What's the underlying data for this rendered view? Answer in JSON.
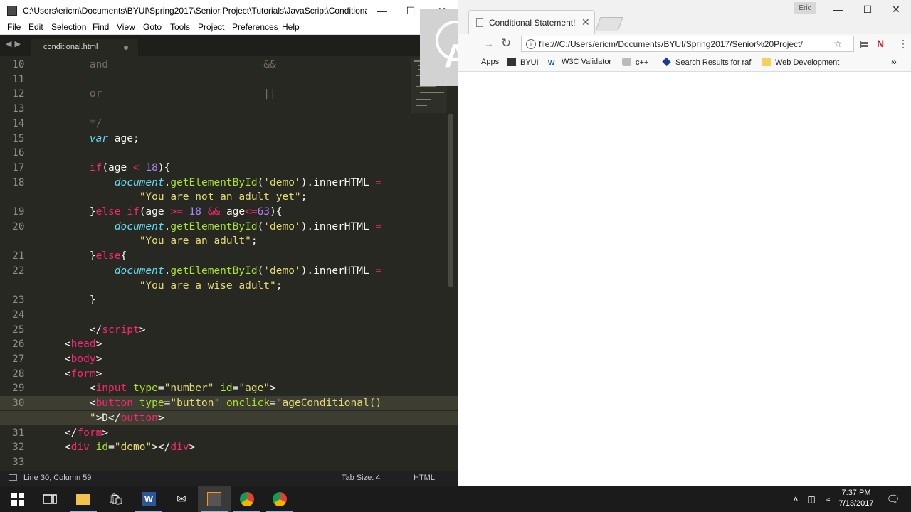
{
  "sublime": {
    "title": "C:\\Users\\ericm\\Documents\\BYUI\\Spring2017\\Senior Project\\Tutorials\\JavaScript\\Conditional St...",
    "menu": [
      "File",
      "Edit",
      "Selection",
      "Find",
      "View",
      "Goto",
      "Tools",
      "Project",
      "Preferences",
      "Help"
    ],
    "tab_label": "conditional.html",
    "status": {
      "position": "Line 30, Column 59",
      "tab_size": "Tab Size: 4",
      "syntax": "HTML"
    },
    "lines": [
      {
        "num": "10",
        "tokens": [
          [
            "c",
            "        and                         &&"
          ]
        ]
      },
      {
        "num": "11",
        "tokens": []
      },
      {
        "num": "12",
        "tokens": [
          [
            "c",
            "        or                          ||"
          ]
        ]
      },
      {
        "num": "13",
        "tokens": []
      },
      {
        "num": "14",
        "tokens": [
          [
            "c",
            "        */"
          ]
        ]
      },
      {
        "num": "15",
        "tokens": [
          [
            "w",
            "        "
          ],
          [
            "i",
            "var"
          ],
          [
            "w",
            " age;"
          ]
        ]
      },
      {
        "num": "16",
        "tokens": []
      },
      {
        "num": "17",
        "tokens": [
          [
            "w",
            "        "
          ],
          [
            "k",
            "if"
          ],
          [
            "w",
            "(age "
          ],
          [
            "k",
            "<"
          ],
          [
            "w",
            " "
          ],
          [
            "n",
            "18"
          ],
          [
            "w",
            "){"
          ]
        ]
      },
      {
        "num": "18",
        "tokens": [
          [
            "w",
            "            "
          ],
          [
            "i",
            "document"
          ],
          [
            "w",
            "."
          ],
          [
            "f",
            "getElementById"
          ],
          [
            "w",
            "("
          ],
          [
            "s",
            "'demo'"
          ],
          [
            "w",
            ").innerHTML "
          ],
          [
            "k",
            "="
          ]
        ]
      },
      {
        "num": "",
        "tokens": [
          [
            "w",
            "                "
          ],
          [
            "s",
            "\"You are not an adult yet\""
          ],
          [
            "w",
            ";"
          ]
        ]
      },
      {
        "num": "19",
        "tokens": [
          [
            "w",
            "        }"
          ],
          [
            "k",
            "else if"
          ],
          [
            "w",
            "(age "
          ],
          [
            "k",
            ">="
          ],
          [
            "w",
            " "
          ],
          [
            "n",
            "18"
          ],
          [
            "w",
            " "
          ],
          [
            "k",
            "&&"
          ],
          [
            "w",
            " age"
          ],
          [
            "k",
            "<="
          ],
          [
            "n",
            "63"
          ],
          [
            "w",
            "){"
          ]
        ]
      },
      {
        "num": "20",
        "tokens": [
          [
            "w",
            "            "
          ],
          [
            "i",
            "document"
          ],
          [
            "w",
            "."
          ],
          [
            "f",
            "getElementById"
          ],
          [
            "w",
            "("
          ],
          [
            "s",
            "'demo'"
          ],
          [
            "w",
            ").innerHTML "
          ],
          [
            "k",
            "="
          ]
        ]
      },
      {
        "num": "",
        "tokens": [
          [
            "w",
            "                "
          ],
          [
            "s",
            "\"You are an adult\""
          ],
          [
            "w",
            ";"
          ]
        ]
      },
      {
        "num": "21",
        "tokens": [
          [
            "w",
            "        }"
          ],
          [
            "k",
            "else"
          ],
          [
            "w",
            "{"
          ]
        ]
      },
      {
        "num": "22",
        "tokens": [
          [
            "w",
            "            "
          ],
          [
            "i",
            "document"
          ],
          [
            "w",
            "."
          ],
          [
            "f",
            "getElementById"
          ],
          [
            "w",
            "("
          ],
          [
            "s",
            "'demo'"
          ],
          [
            "w",
            ").innerHTML "
          ],
          [
            "k",
            "="
          ]
        ]
      },
      {
        "num": "",
        "tokens": [
          [
            "w",
            "                "
          ],
          [
            "s",
            "\"You are a wise adult\""
          ],
          [
            "w",
            ";"
          ]
        ]
      },
      {
        "num": "23",
        "tokens": [
          [
            "w",
            "        }"
          ]
        ]
      },
      {
        "num": "24",
        "tokens": []
      },
      {
        "num": "25",
        "tokens": [
          [
            "w",
            "        </"
          ],
          [
            "k",
            "script"
          ],
          [
            "w",
            ">"
          ]
        ]
      },
      {
        "num": "26",
        "tokens": [
          [
            "w",
            "    <"
          ],
          [
            "k",
            "head"
          ],
          [
            "w",
            ">"
          ]
        ]
      },
      {
        "num": "27",
        "tokens": [
          [
            "w",
            "    <"
          ],
          [
            "k",
            "body"
          ],
          [
            "w",
            ">"
          ]
        ]
      },
      {
        "num": "28",
        "tokens": [
          [
            "w",
            "    <"
          ],
          [
            "k",
            "form"
          ],
          [
            "w",
            ">"
          ]
        ]
      },
      {
        "num": "29",
        "tokens": [
          [
            "w",
            "        <"
          ],
          [
            "k",
            "input"
          ],
          [
            "w",
            " "
          ],
          [
            "a",
            "type"
          ],
          [
            "w",
            "="
          ],
          [
            "s",
            "\"number\""
          ],
          [
            "w",
            " "
          ],
          [
            "a",
            "id"
          ],
          [
            "w",
            "="
          ],
          [
            "s",
            "\"age\""
          ],
          [
            "w",
            ">"
          ]
        ]
      },
      {
        "num": "30",
        "current": true,
        "tokens": [
          [
            "w",
            "        <"
          ],
          [
            "k",
            "button"
          ],
          [
            "w",
            " "
          ],
          [
            "a",
            "type"
          ],
          [
            "w",
            "="
          ],
          [
            "s",
            "\"button\""
          ],
          [
            "w",
            " "
          ],
          [
            "a",
            "onclick"
          ],
          [
            "w",
            "="
          ],
          [
            "s",
            "\"ageConditional()"
          ]
        ]
      },
      {
        "num": "",
        "current": true,
        "tokens": [
          [
            "w",
            "        "
          ],
          [
            "s",
            "\""
          ],
          [
            "w",
            ">D</"
          ],
          [
            "k",
            "button"
          ],
          [
            "w",
            ">"
          ]
        ]
      },
      {
        "num": "31",
        "tokens": [
          [
            "w",
            "    </"
          ],
          [
            "k",
            "form"
          ],
          [
            "w",
            ">"
          ]
        ]
      },
      {
        "num": "32",
        "tokens": [
          [
            "w",
            "    <"
          ],
          [
            "k",
            "div"
          ],
          [
            "w",
            " "
          ],
          [
            "a",
            "id"
          ],
          [
            "w",
            "="
          ],
          [
            "s",
            "\"demo\""
          ],
          [
            "w",
            "></"
          ],
          [
            "k",
            "div"
          ],
          [
            "w",
            ">"
          ]
        ]
      },
      {
        "num": "33",
        "tokens": []
      }
    ]
  },
  "chrome": {
    "tab_title": "Conditional Statement!",
    "user_label": "Eric",
    "url": "file:///C:/Users/ericm/Documents/BYUI/Spring2017/Senior%20Project/",
    "bookmarks": [
      {
        "label": "Apps",
        "icon": "apps-icon"
      },
      {
        "label": "BYUI",
        "icon": "byui-icon"
      },
      {
        "label": "W3C Validator",
        "icon": "w3c-icon"
      },
      {
        "label": "c++",
        "icon": "cpp-icon"
      },
      {
        "label": "Search Results for raf",
        "icon": "diamond-icon"
      },
      {
        "label": "Web Development",
        "icon": "folder-icon"
      }
    ],
    "more_bookmarks": "»"
  },
  "taskbar": {
    "time": "7:37 PM",
    "date": "7/13/2017"
  },
  "colors": {
    "editor_bg": "#272822",
    "keyword": "#f92672",
    "string": "#e6db74",
    "number": "#ae81ff",
    "function": "#a6e22e",
    "italic_type": "#66d9ef",
    "comment": "#75715e"
  }
}
